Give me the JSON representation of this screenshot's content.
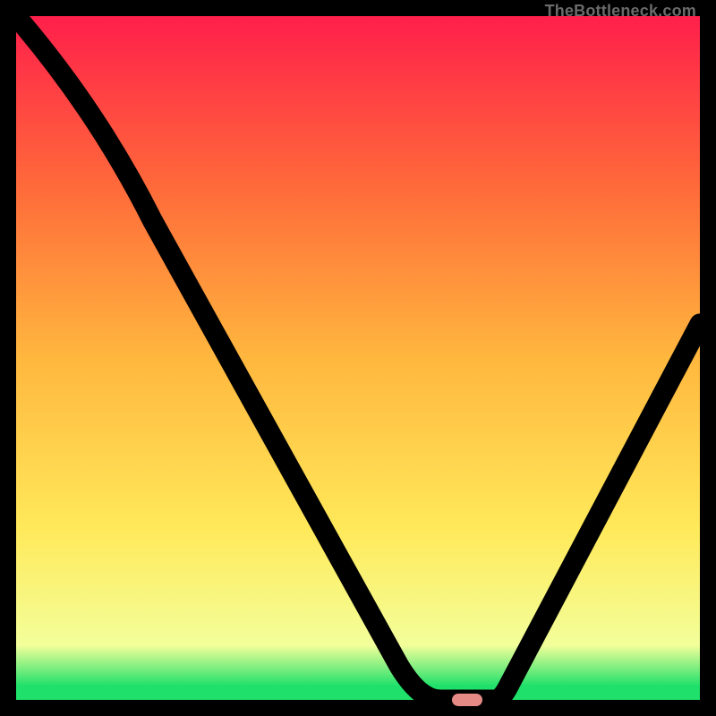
{
  "watermark": "TheBottleneck.com",
  "colors": {
    "gradient": [
      "#ff1f4b",
      "#ff6a3a",
      "#ffb73e",
      "#ffe95a",
      "#f3ff9a",
      "#1fe06a"
    ],
    "marker": "#e68a86",
    "curve": "#000000"
  },
  "chart_data": {
    "type": "line",
    "title": "",
    "xlabel": "",
    "ylabel": "",
    "xlim": [
      0,
      100
    ],
    "ylim": [
      0,
      100
    ],
    "grid": false,
    "legend": false,
    "curve_points": [
      {
        "x": 0,
        "y": 100
      },
      {
        "x": 20,
        "y": 70
      },
      {
        "x": 56,
        "y": 5
      },
      {
        "x": 62,
        "y": 0
      },
      {
        "x": 70,
        "y": 0
      },
      {
        "x": 72,
        "y": 2
      },
      {
        "x": 100,
        "y": 55
      }
    ],
    "marker": {
      "x": 66,
      "y": 0
    }
  }
}
